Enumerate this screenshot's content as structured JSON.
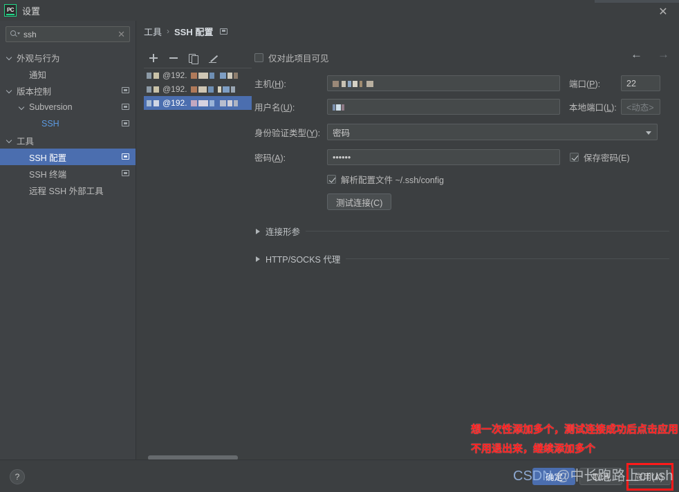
{
  "window": {
    "title": "设置",
    "logo_text": "PC",
    "close_icon": "✕"
  },
  "search": {
    "value": "ssh",
    "clear_icon": "✕"
  },
  "sidebar": {
    "items": [
      {
        "label": "外观与行为",
        "indent": 0,
        "chevron": true,
        "selected": false,
        "link": false,
        "config_icon": false
      },
      {
        "label": "通知",
        "indent": 1,
        "chevron": false,
        "selected": false,
        "link": false,
        "config_icon": false
      },
      {
        "label": "版本控制",
        "indent": 0,
        "chevron": true,
        "selected": false,
        "link": false,
        "config_icon": true
      },
      {
        "label": "Subversion",
        "indent": 1,
        "chevron": true,
        "selected": false,
        "link": false,
        "config_icon": true
      },
      {
        "label": "SSH",
        "indent": 2,
        "chevron": false,
        "selected": false,
        "link": true,
        "config_icon": true
      },
      {
        "label": "工具",
        "indent": 0,
        "chevron": true,
        "selected": false,
        "link": false,
        "config_icon": false
      },
      {
        "label": "SSH 配置",
        "indent": 1,
        "chevron": false,
        "selected": true,
        "link": false,
        "config_icon": true
      },
      {
        "label": "SSH 终端",
        "indent": 1,
        "chevron": false,
        "selected": false,
        "link": false,
        "config_icon": true
      },
      {
        "label": "远程 SSH 外部工具",
        "indent": 1,
        "chevron": false,
        "selected": false,
        "link": false,
        "config_icon": false
      }
    ]
  },
  "breadcrumb": {
    "root": "工具",
    "separator": "›",
    "current": "SSH 配置"
  },
  "nav": {
    "back_icon": "←",
    "forward_icon": "→"
  },
  "list_toolbar": {
    "add_label": "+",
    "remove_label": "−",
    "copy_label": "copy",
    "edit_label": "edit"
  },
  "ssh_list": {
    "items": [
      {
        "text": "@192.",
        "selected": false
      },
      {
        "text": "@192.",
        "selected": false
      },
      {
        "text": "@192.",
        "selected": true
      }
    ]
  },
  "form": {
    "visible_project_only": {
      "label": "仅对此项目可见",
      "checked": false
    },
    "host": {
      "label": "主机(H)",
      "mnemonic": "H",
      "value": ""
    },
    "port": {
      "label": "端口(P)",
      "mnemonic": "P",
      "value": "22"
    },
    "username": {
      "label": "用户名(U)",
      "mnemonic": "U",
      "value": ""
    },
    "local_port": {
      "label": "本地端口(L)",
      "mnemonic": "L",
      "placeholder": "<动态>"
    },
    "auth_type": {
      "label": "身份验证类型(Y)",
      "mnemonic": "Y",
      "value": "密码"
    },
    "password": {
      "label": "密码(A)",
      "mnemonic": "A",
      "value": "••••••"
    },
    "save_password": {
      "label": "保存密码(E)",
      "checked": true
    },
    "parse_config": {
      "label": "解析配置文件 ~/.ssh/config",
      "checked": true
    },
    "test_connection_button": "测试连接(C)",
    "sections": [
      {
        "label": "连接形参",
        "expanded": false
      },
      {
        "label": "HTTP/SOCKS 代理",
        "expanded": false
      }
    ]
  },
  "annotation": {
    "line1": "想一次性添加多个，测试连接成功后点击应用，",
    "line2": "不用退出来，继续添加多个",
    "color": "#ff1a1a"
  },
  "bottom": {
    "help_label": "?",
    "buttons": [
      {
        "label": "确定",
        "kind": "primary",
        "highlighted": false
      },
      {
        "label": "取消",
        "kind": "normal",
        "highlighted": false
      },
      {
        "label": "应用(A)",
        "kind": "normal",
        "highlighted": true
      }
    ]
  },
  "watermark": {
    "brand": "CSDN",
    "user": "@中长跑路上crush"
  },
  "colors": {
    "accent": "#4b6eaf",
    "background": "#3c3f41",
    "sidebar": "#3f4245",
    "field": "#45494a",
    "link": "#5c9ae0",
    "annotation": "#ff1a1a"
  }
}
